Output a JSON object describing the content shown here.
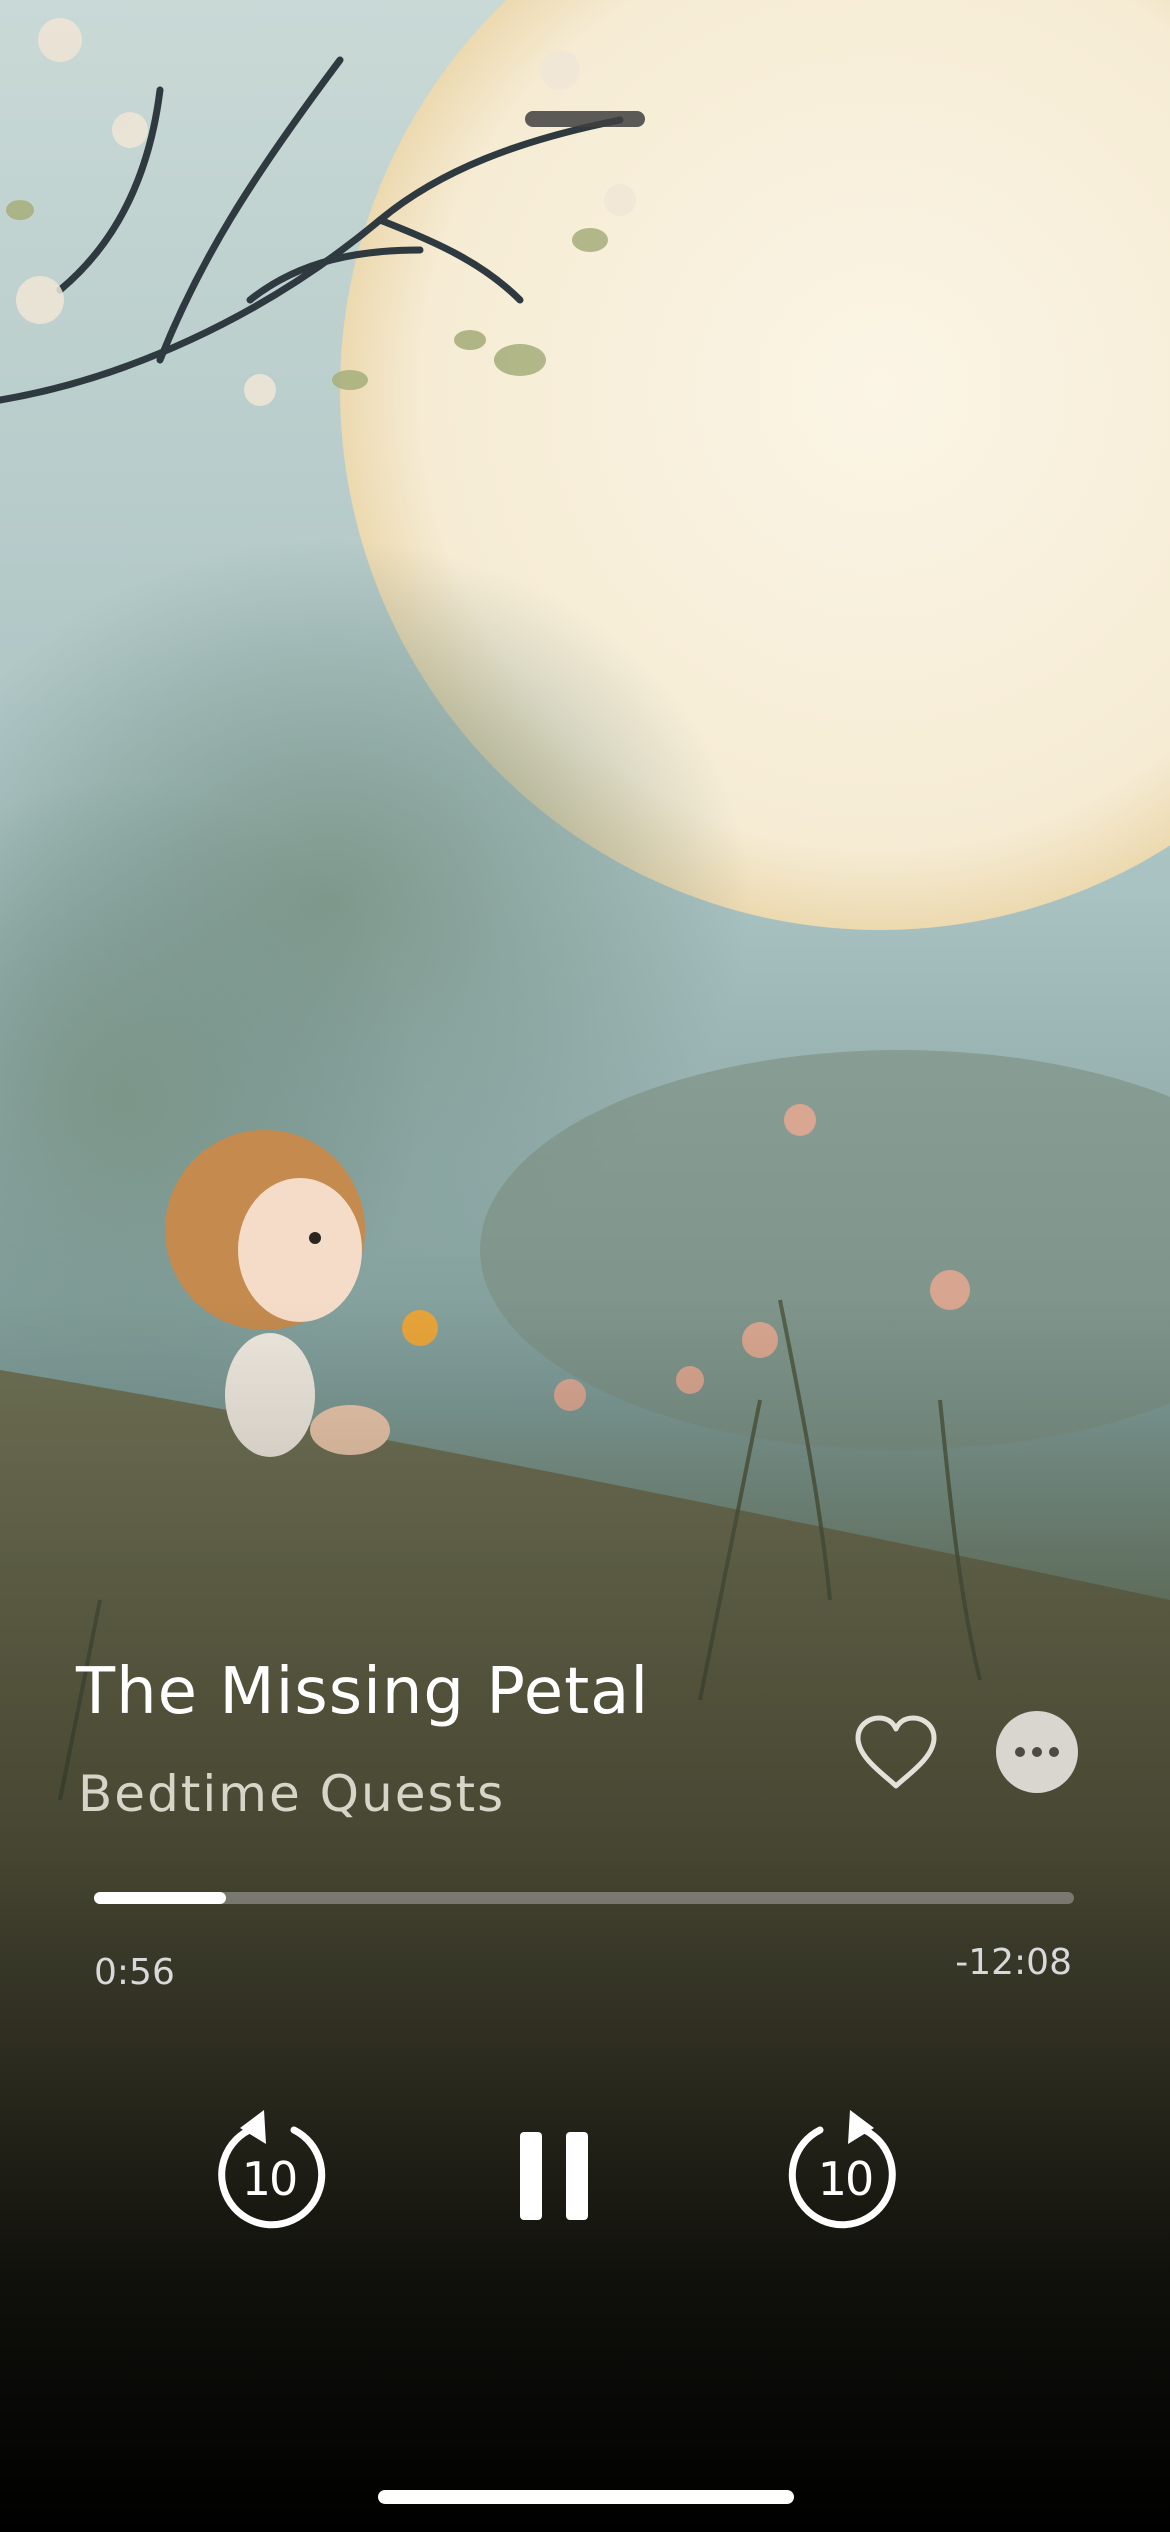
{
  "episode": {
    "title": "The Missing Petal",
    "series": "Bedtime Quests"
  },
  "playback": {
    "elapsed": "0:56",
    "remaining": "-12:08",
    "progress": 0.135
  },
  "controls": {
    "skip_back_seconds": "10",
    "skip_forward_seconds": "10"
  },
  "icons": {
    "favorite": "heart-outline-icon",
    "more": "ellipsis-icon",
    "skip_back": "rotate-ccw-icon",
    "pause": "pause-icon",
    "skip_forward": "rotate-cw-icon"
  },
  "colors": {
    "accent": "#ffffff",
    "track": "#bebebe",
    "more_button": "#d9d6d0"
  }
}
